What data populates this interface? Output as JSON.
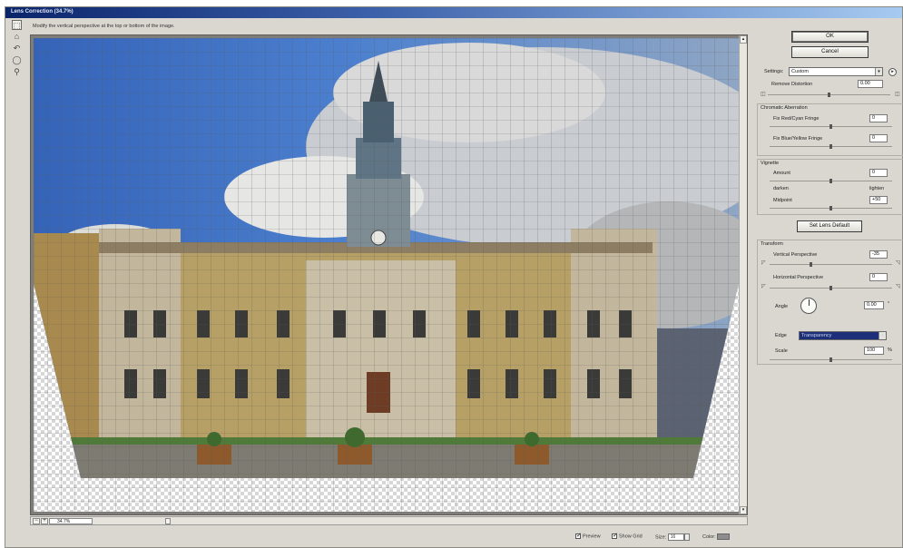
{
  "window": {
    "title": "Lens Correction (34.7%)"
  },
  "tools": [
    {
      "name": "remove-distortion-tool-icon",
      "glyph": "⬚"
    },
    {
      "name": "straighten-tool-icon",
      "glyph": "⌂"
    },
    {
      "name": "move-grid-tool-icon",
      "glyph": "↶"
    },
    {
      "name": "hand-tool-icon",
      "glyph": "◯"
    },
    {
      "name": "zoom-tool-icon",
      "glyph": "⚲"
    }
  ],
  "hint": "Modify the vertical perspective at the top or bottom of the image.",
  "buttons": {
    "ok": "OK",
    "cancel": "Cancel",
    "lens_default": "Set Lens Default"
  },
  "settings": {
    "label": "Settings:",
    "value": "Custom",
    "remove_distortion": {
      "label": "Remove Distortion",
      "value": "0.00",
      "fraction": 0.5
    }
  },
  "chromatic": {
    "title": "Chromatic Aberration",
    "red_cyan": {
      "label": "Fix Red/Cyan Fringe",
      "value": "0",
      "fraction": 0.5
    },
    "blue_yellow": {
      "label": "Fix Blue/Yellow Fringe",
      "value": "0",
      "fraction": 0.5
    }
  },
  "vignette": {
    "title": "Vignette",
    "amount": {
      "label": "Amount",
      "value": "0",
      "fraction": 0.5
    },
    "darken": "darken",
    "lighten": "lighten",
    "midpoint": {
      "label": "Midpoint",
      "value": "+50",
      "fraction": 0.5
    }
  },
  "transform": {
    "title": "Transform",
    "vertical": {
      "label": "Vertical Perspective",
      "value": "-35",
      "fraction": 0.33
    },
    "horizontal": {
      "label": "Horizontal Perspective",
      "value": "0",
      "fraction": 0.5
    },
    "angle": {
      "label": "Angle",
      "value": "0.00",
      "unit": "°"
    },
    "edge": {
      "label": "Edge",
      "value": "Transparency"
    },
    "scale": {
      "label": "Scale",
      "value": "100",
      "unit": "%",
      "fraction": 0.5
    }
  },
  "status": {
    "zoom": "34.7%"
  },
  "options": {
    "preview": "Preview",
    "show_grid": "Show Grid",
    "size_label": "Size:",
    "size_value": "16",
    "color_label": "Color:",
    "grid_color": "#8e8e8e"
  },
  "photo_colors": {
    "sky": "#3d6fc4",
    "facade": "#b9a36d",
    "plaza": "#7d7b72"
  }
}
